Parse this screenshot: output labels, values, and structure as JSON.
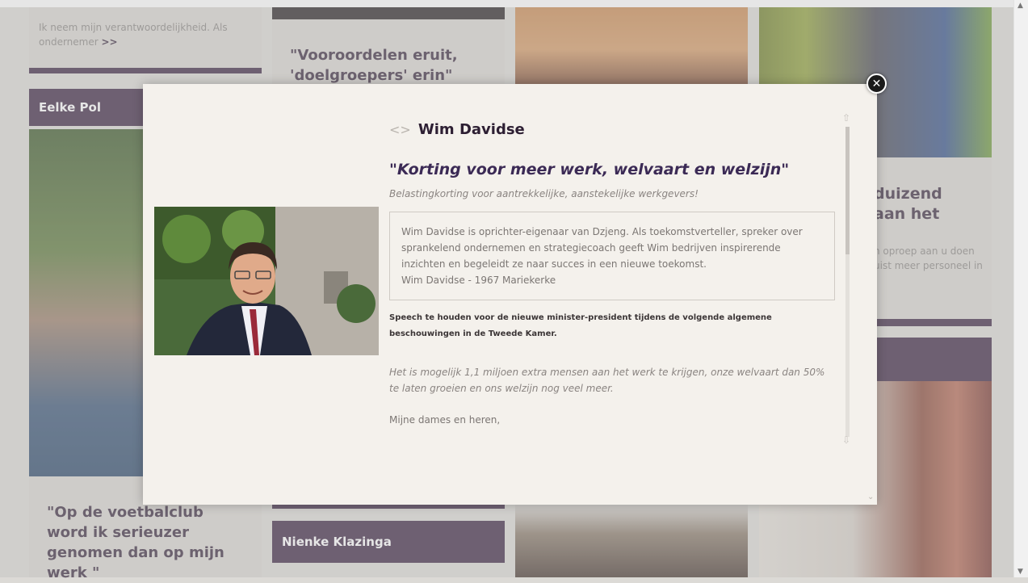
{
  "background": {
    "tile_text_top_left": "Ik neem mijn verantwoordelijkheid. Als ondernemer",
    "tile_text_top_left_link": ">>",
    "quote_top_middle": "\"Vooroordelen eruit, 'doelgroepers' erin\"",
    "name_left": "Eelke Pol",
    "quote_right_partial": "duizend aan het",
    "text_right_partial": "n oproep aan u doen uist meer personeel in",
    "quote_bottom_left": "\"Op de voetbalclub word ik serieuzer genomen dan op mijn werk \"",
    "name_bottom_middle": "Nienke Klazinga"
  },
  "modal": {
    "nav_arrows": "<>",
    "name": "Wim Davidse",
    "headline": "\"Korting voor meer werk, welvaart en welzijn\"",
    "subline": "Belastingkorting voor aantrekkelijke, aanstekelijke werkgevers!",
    "bio_text": "Wim Davidse is oprichter-eigenaar van Dzjeng. Als toekomstverteller, spreker over sprankelend ondernemen en strategiecoach geeft Wim bedrijven inspirerende inzichten en begeleidt ze naar succes in een nieuwe toekomst.",
    "bio_line": "Wim Davidse - 1967 Mariekerke",
    "speech_intro": "Speech te houden voor de nieuwe minister-president tijdens de volgende algemene beschouwingen in de Tweede Kamer.",
    "italic_paragraph": "Het is mogelijk 1,1 miljoen extra mensen aan het werk te krijgen, onze welvaart dan 50% te laten groeien en ons welzijn nog veel meer.",
    "paragraph": "Mijne dames en heren,",
    "close_icon": "close-icon",
    "close_glyph": "✕"
  },
  "colors": {
    "accent_purple": "#3e2744",
    "headline_purple": "#3b2a55",
    "modal_bg": "#f4f1ec"
  }
}
